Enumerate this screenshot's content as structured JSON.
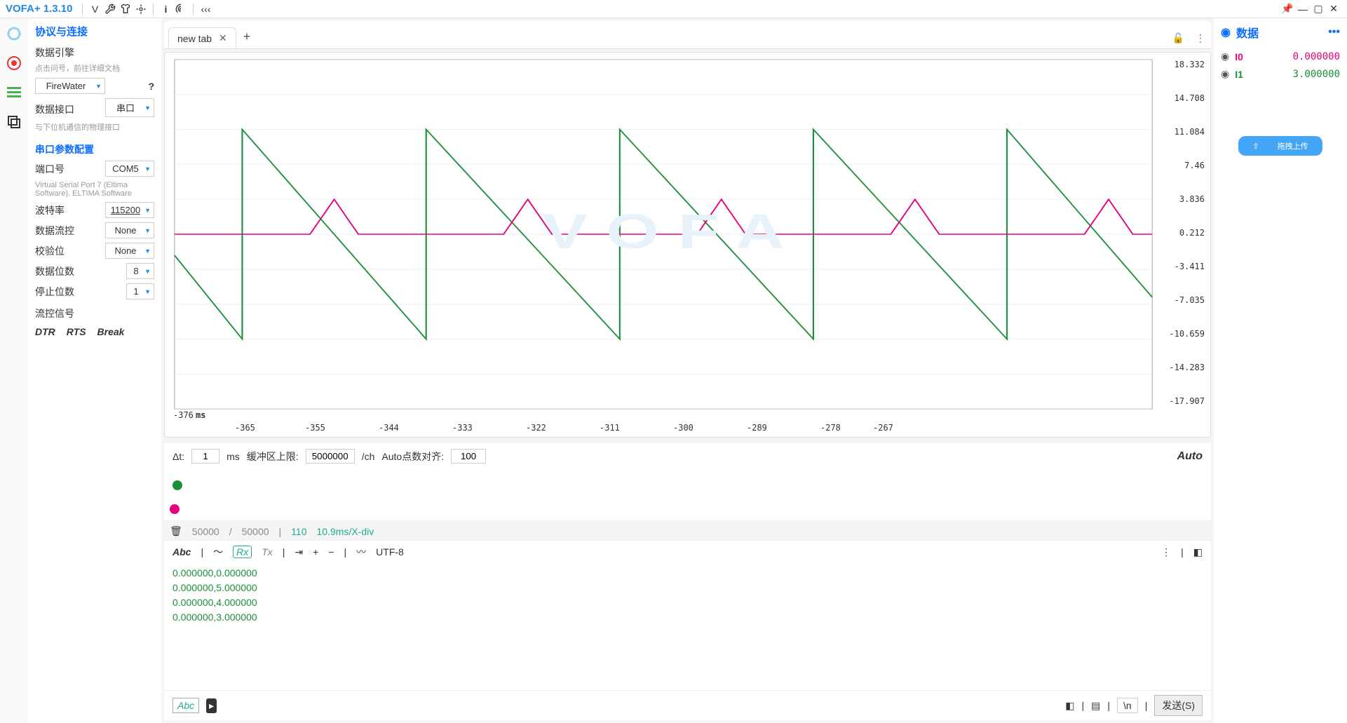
{
  "app": {
    "title": "VOFA+ 1.3.10"
  },
  "sidebar": {
    "header": "协议与连接",
    "engine_label": "数据引擎",
    "engine_hint": "点击问号，前往详细文档",
    "engine_value": "FireWater",
    "interface_label": "数据接口",
    "interface_value": "串口",
    "interface_hint": "与下位机通信的物理接口",
    "serial_hdr": "串口参数配置",
    "port_label": "端口号",
    "port_value": "COM5",
    "port_hint": "Virtual Serial Port 7 (Eltima Software), ELTIMA Software",
    "baud_label": "波特率",
    "baud_value": "115200",
    "flow_label": "数据流控",
    "flow_value": "None",
    "parity_label": "校验位",
    "parity_value": "None",
    "databits_label": "数据位数",
    "databits_value": "8",
    "stopbits_label": "停止位数",
    "stopbits_value": "1",
    "sig_label": "流控信号",
    "sig_dtr": "DTR",
    "sig_rts": "RTS",
    "sig_break": "Break"
  },
  "tabs": {
    "name": "new tab"
  },
  "chart_data": {
    "type": "line",
    "xlabel": "ms",
    "x_ticks": [
      -376,
      -365,
      -355,
      -344,
      -333,
      -322,
      -311,
      -300,
      -289,
      -278,
      -267
    ],
    "y_ticks": [
      18.332,
      14.708,
      11.084,
      7.46,
      3.836,
      0.212,
      -3.411,
      -7.035,
      -10.659,
      -14.283,
      -17.907
    ],
    "series": [
      {
        "name": "I0",
        "color": "#e6007e"
      },
      {
        "name": "I1",
        "color": "#1a8f3a"
      }
    ]
  },
  "ctrl": {
    "dt_label": "Δt:",
    "dt_value": "1",
    "dt_unit": "ms",
    "buf_label": "缓冲区上限:",
    "buf_value": "5000000",
    "buf_unit": "/ch",
    "auto_label": "Auto点数对齐:",
    "auto_value": "100",
    "auto_text": "Auto",
    "stat_cur": "50000",
    "stat_sep": "/",
    "stat_max": "50000",
    "stat_interval": "110",
    "stat_scale": "10.9ms/X-div"
  },
  "rx": {
    "abc": "Abc",
    "rx": "Rx",
    "tx": "Tx",
    "enc": "UTF-8",
    "lines": [
      "0.000000,0.000000",
      "0.000000,5.000000",
      "0.000000,4.000000",
      "0.000000,3.000000"
    ]
  },
  "send": {
    "abc": "Abc",
    "newline": "\\n",
    "btn": "发送(S)"
  },
  "right": {
    "hdr": "数据",
    "rows": [
      {
        "label": "I0",
        "value": "0.000000"
      },
      {
        "label": "I1",
        "value": "3.000000"
      }
    ],
    "upload": "拖拽上传"
  }
}
